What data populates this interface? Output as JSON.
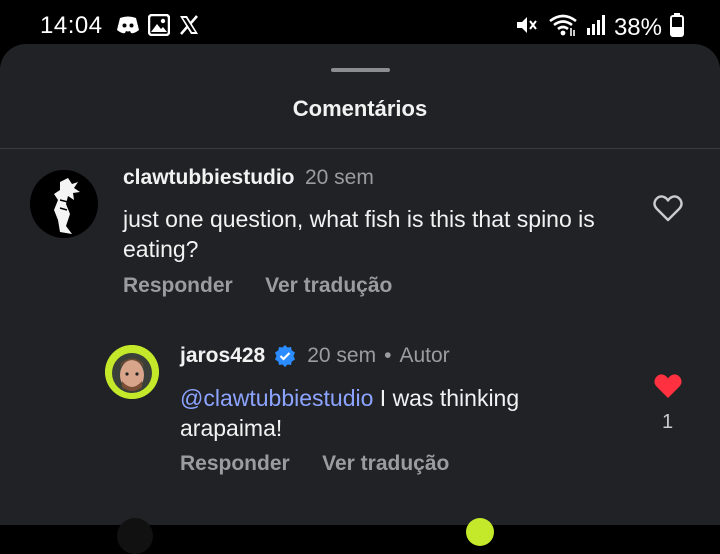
{
  "status_bar": {
    "time": "14:04",
    "left_icons": [
      "discord-icon",
      "gallery-icon",
      "x-icon"
    ],
    "right_icons": [
      "mute-icon",
      "wifi-icon",
      "signal-icon",
      "battery-icon"
    ],
    "battery": "38%"
  },
  "sheet": {
    "title": "Comentários"
  },
  "comments": [
    {
      "username": "clawtubbiestudio",
      "time": "20 sem",
      "text": "just one question, what fish is this that spino is eating?",
      "reply_label": "Responder",
      "translate_label": "Ver tradução",
      "liked": false,
      "like_count": ""
    },
    {
      "username": "jaros428",
      "verified": true,
      "time": "20 sem",
      "separator": "•",
      "author_badge": "Autor",
      "mention": "@clawtubbiestudio",
      "text_line1": " I was thinking",
      "text_line2": "arapaima!",
      "reply_label": "Responder",
      "translate_label": "Ver tradução",
      "liked": true,
      "like_count": "1"
    }
  ],
  "colors": {
    "sheet_bg": "#212226",
    "mention": "#8ca4ff",
    "like_red": "#ff3040",
    "verified_blue": "#2b8cff"
  }
}
